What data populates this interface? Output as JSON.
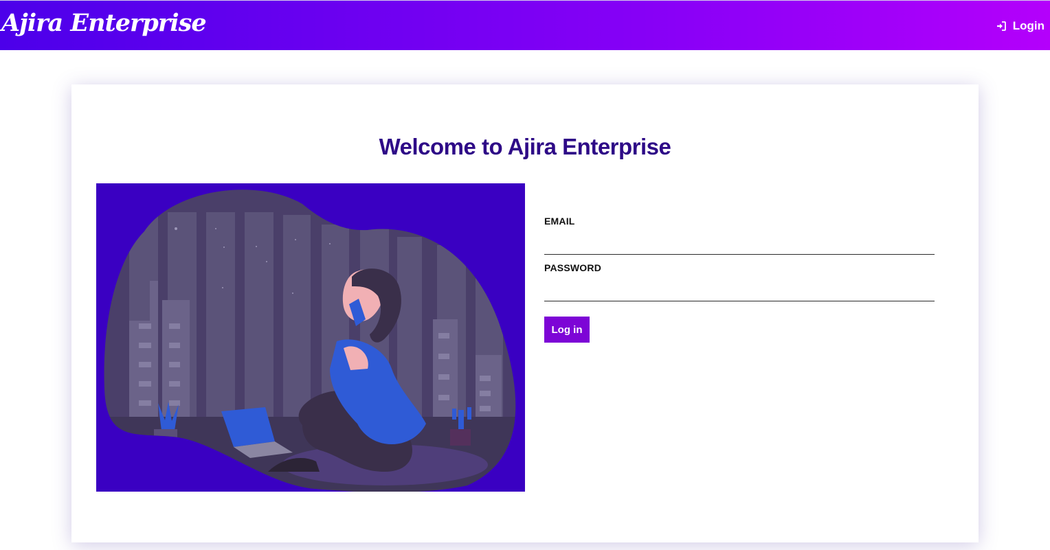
{
  "header": {
    "brand": "Ajira Enterprise",
    "login_label": "Login",
    "login_icon": "sign-in-icon"
  },
  "main": {
    "welcome_title": "Welcome to Ajira Enterprise",
    "illustration": "woman-on-phone-with-laptop-city-night-illustration"
  },
  "form": {
    "email_label": "EMAIL",
    "email_value": "",
    "password_label": "PASSWORD",
    "password_value": "",
    "submit_label": "Log in"
  },
  "colors": {
    "header_gradient_start": "#4c00ea",
    "header_gradient_end": "#b400fb",
    "title": "#2e0a87",
    "button": "#7d05d6",
    "illustration_bg": "#3a00c2"
  }
}
